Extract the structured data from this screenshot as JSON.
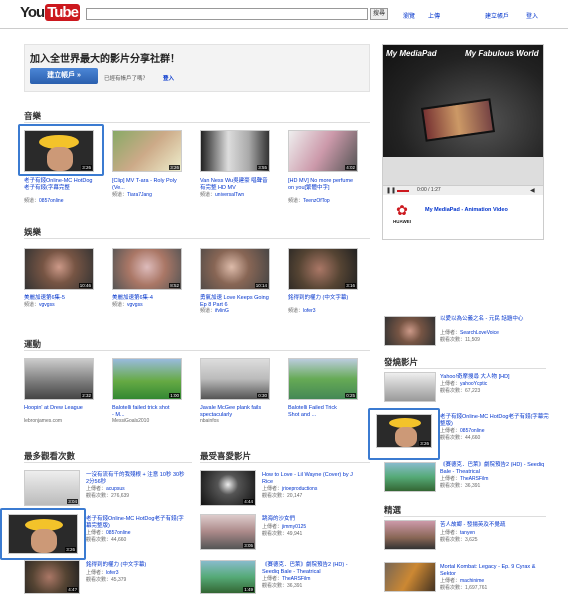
{
  "header": {
    "logo_you": "You",
    "logo_tube": "Tube",
    "search_placeholder": "",
    "search_button": "搜尋",
    "links": [
      "瀏覽",
      "上傳"
    ],
    "create_account": "建立帳戶",
    "sign_in": "登入"
  },
  "promo": {
    "headline": "加入全世界最大的影片分享社群！",
    "create_btn": "建立帳戶 »",
    "already": "已經有帳戶了嗎？",
    "signin": "登入"
  },
  "ad": {
    "banner_left": "My MediaPad",
    "banner_right": "My Fabulous World",
    "time": "0:00 / 1:27",
    "brand": "HUAWEI",
    "caption": "My MediaPad - Animation Video"
  },
  "sections": {
    "music": "音樂",
    "entertainment": "娛樂",
    "sports": "運動",
    "most_viewed": "最多觀看次數",
    "top_favorites": "最受喜愛影片",
    "featured": "發燒影片",
    "spotlight": "精選"
  },
  "music": [
    {
      "title": "老子有錢Online-MC HotDog老子有錢(字幕完整",
      "by": "0857online",
      "dur": "3:26"
    },
    {
      "title": "[Clip] MV T-ara - Roly Poly (Ve...",
      "by": "Tiara7Jang",
      "dur": "3:26"
    },
    {
      "title": "Van Ness Wu吳建豪 唱聲音有完整 HD MV",
      "by": "universalTwn",
      "dur": "3:55"
    },
    {
      "title": "[HD MV] No more perfume on you[繁體中字]",
      "by": "TeenzOfTop",
      "dur": "4:02"
    }
  ],
  "entertainment": [
    {
      "title": "美麗加速第6集-5",
      "by": "vgvgss",
      "dur": "10:46"
    },
    {
      "title": "美麗加速第6集-4",
      "by": "vgvgss",
      "dur": "8:52"
    },
    {
      "title": "勇氣加速 Love Keeps Going Ep 8 Part 6",
      "by": "ifvlinG",
      "dur": "10:14"
    },
    {
      "title": "銘得到的權力 (中文字幕)",
      "by": "lofer3",
      "dur": "3:16"
    }
  ],
  "sports": [
    {
      "title": "Hoopin' at Drew League",
      "by": "lebronjames.com",
      "dur": "2:32"
    },
    {
      "title": "Balotelli failed trick shot - M...",
      "by": "MessiGoals2010",
      "dur": "1:00"
    },
    {
      "title": "Javale McGee plank fails spectacularly",
      "by": "nbainfos",
      "dur": "0:30"
    },
    {
      "title": "Balotelli Failed Trick Shot and ...",
      "by": "",
      "dur": "0:25"
    }
  ],
  "most_viewed": [
    {
      "title": "一沒有流有千的我殘根 + 注意 10秒 30秒 2分56秒",
      "by": "acupsus",
      "views": "276,639",
      "dur": "3:04"
    },
    {
      "title": "老子有錢Online-MC HotDog老子有錢(字幕完整版)",
      "by": "0857online",
      "views": "44,660",
      "dur": "3:26"
    },
    {
      "title": "銘得到的權力 (中文字幕)",
      "by": "lofer3",
      "views": "45,379",
      "dur": "4:4?"
    }
  ],
  "top_favorites": [
    {
      "title": "How to Love - Lil Wayne (Cover) by J Rice",
      "by": "jrioeproductions",
      "views": "20,147",
      "dur": "4:44"
    },
    {
      "title": "跳海的沙女們",
      "by": "jimmy0125",
      "views": "49,941",
      "dur": "3:05"
    },
    {
      "title": "《賽德克．巴萊》劇院預告2 (HD) - Seediq Bale - Theatrical",
      "by": "TheARSFilm",
      "views": "36,391",
      "dur": "1:49"
    }
  ],
  "side_top": {
    "title": "以愛以為公義之名 - 元民 話題中心",
    "by": "SearchLoveVoice",
    "views": "11,509"
  },
  "featured": [
    {
      "title": "Yahoo!奇摩搜尋 大人物 [HD]",
      "by": "yahooYcptic",
      "views": "67,223"
    },
    {
      "title": "老子有錢Online-MC HotDog老子有錢(字幕完整版)",
      "by": "0857online",
      "views": "44,660",
      "dur": "3:26"
    },
    {
      "title": "《賽德克．巴萊》劇院預告2 (HD) - Seediq Bale - Theatrical",
      "by": "TheARSFilm",
      "views": "36,391"
    }
  ],
  "spotlight": [
    {
      "title": "苦人故鄉 - 發揚英及不覺疏",
      "by": "tanyen",
      "views": "3,625"
    },
    {
      "title": "Mortal Kombat: Legacy - Ep. 9 Cyrax & Sektor",
      "by": "machinime",
      "views": "1,697,761"
    }
  ],
  "labels": {
    "by_prefix": "頻道：",
    "uploader": "上傳者：",
    "views": "觀看次數："
  },
  "colors": {
    "red": "#cc181e",
    "button_blue": "#3a72c4",
    "highlight": "#3b7bd1"
  }
}
